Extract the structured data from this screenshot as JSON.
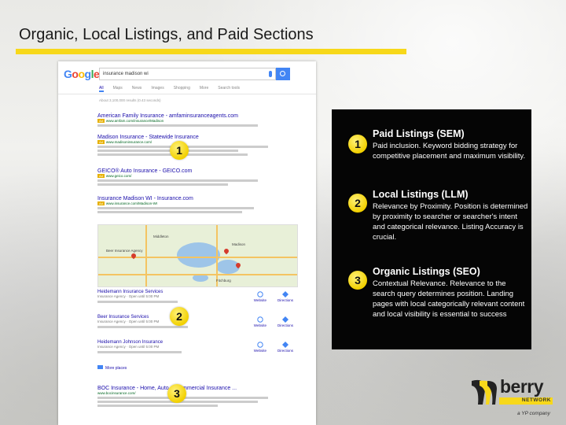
{
  "slide": {
    "title": "Organic, Local Listings, and Paid Sections"
  },
  "serp": {
    "logo": [
      "G",
      "o",
      "o",
      "g",
      "l",
      "e"
    ],
    "query": "insurance madison wi",
    "tabs": [
      "All",
      "Maps",
      "News",
      "Images",
      "Shopping",
      "More",
      "Search tools"
    ],
    "stats": "About 3,100,000 results (0.43 seconds)",
    "ad_label": "Ad",
    "ads": [
      {
        "title": "American Family Insurance - amfaminsuranceagents.com",
        "url": "www.amfam.com/insurance/Madison"
      },
      {
        "title": "Madison Insurance - Statewide Insurance",
        "url": "www.madisoninsurance.com/"
      },
      {
        "title": "GEICO® Auto Insurance - GEICO.com",
        "url": "www.geico.com/"
      },
      {
        "title": "Insurance Madison WI - Insurance.com",
        "url": "www.insurance.com/Madison-WI"
      }
    ],
    "map_labels": [
      "Beer Insurance Agency",
      "Madison",
      "Middleton",
      "Fitchburg"
    ],
    "local": [
      {
        "name": "Heidemann Insurance Services",
        "meta": "Insurance Agency · Open until 5:00 PM",
        "website": "Website",
        "directions": "Directions"
      },
      {
        "name": "Beer Insurance Services",
        "meta": "Insurance Agency · Open until 5:00 PM",
        "website": "Website",
        "directions": "Directions"
      },
      {
        "name": "Heidemann Johnson Insurance",
        "meta": "Insurance Agency · Open until 5:00 PM",
        "website": "Website",
        "directions": "Directions"
      }
    ],
    "more_places": "More places",
    "organic": {
      "title": "BOC Insurance - Home, Auto & Commercial Insurance ...",
      "url": "www.bocinsurance.com/"
    }
  },
  "markers": {
    "paid": "1",
    "local": "2",
    "organic": "3"
  },
  "info": {
    "sections": [
      {
        "num": "1",
        "heading": "Paid Listings (SEM)",
        "desc": "Paid inclusion. Keyword bidding strategy for competitive placement and maximum visibility."
      },
      {
        "num": "2",
        "heading": "Local Listings (LLM)",
        "desc": "Relevance by Proximity. Position is determined by proximity to searcher or searcher's intent and categorical relevance. Listing Accuracy is crucial."
      },
      {
        "num": "3",
        "heading": "Organic Listings (SEO)",
        "desc": "Contextual Relevance. Relevance to the search query determines position. Landing pages with local categorically relevant content and local visibility is essential to success"
      }
    ]
  },
  "logo": {
    "word": "berry",
    "network": "NETWORK",
    "sub": "a YP company",
    "colors": {
      "yellow": "#f7d81a",
      "dark": "#222222"
    }
  }
}
